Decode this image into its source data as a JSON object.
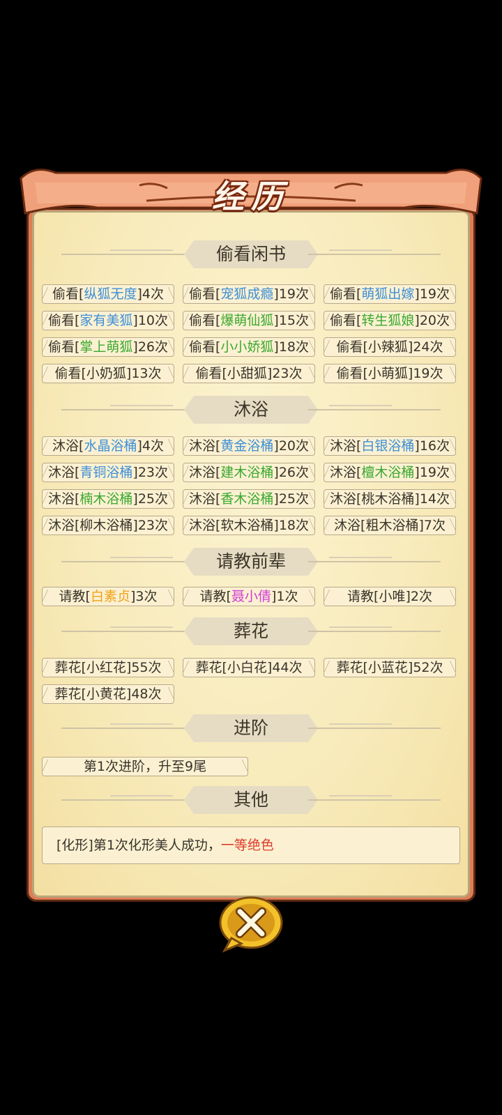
{
  "title": "经历",
  "sections": {
    "peek": {
      "header": "偷看闲书",
      "items": [
        {
          "pre": "偷看[",
          "name": "纵狐无度",
          "post": "]4次",
          "color": "blue"
        },
        {
          "pre": "偷看[",
          "name": "宠狐成瘾",
          "post": "]19次",
          "color": "blue"
        },
        {
          "pre": "偷看[",
          "name": "萌狐出嫁",
          "post": "]19次",
          "color": "blue"
        },
        {
          "pre": "偷看[",
          "name": "家有美狐",
          "post": "]10次",
          "color": "blue"
        },
        {
          "pre": "偷看[",
          "name": "爆萌仙狐",
          "post": "]15次",
          "color": "green"
        },
        {
          "pre": "偷看[",
          "name": "转生狐娘",
          "post": "]20次",
          "color": "green"
        },
        {
          "pre": "偷看[",
          "name": "掌上萌狐",
          "post": "]26次",
          "color": "green"
        },
        {
          "pre": "偷看[",
          "name": "小小娇狐",
          "post": "]18次",
          "color": "green"
        },
        {
          "pre": "偷看[",
          "name": "小辣狐",
          "post": "]24次",
          "color": "plain"
        },
        {
          "pre": "偷看[",
          "name": "小奶狐",
          "post": "]13次",
          "color": "plain"
        },
        {
          "pre": "偷看[",
          "name": "小甜狐",
          "post": "]23次",
          "color": "plain"
        },
        {
          "pre": "偷看[",
          "name": "小萌狐",
          "post": "]19次",
          "color": "plain"
        }
      ]
    },
    "bath": {
      "header": "沐浴",
      "items": [
        {
          "pre": "沐浴[",
          "name": "水晶浴桶",
          "post": "]4次",
          "color": "blue"
        },
        {
          "pre": "沐浴[",
          "name": "黄金浴桶",
          "post": "]20次",
          "color": "blue"
        },
        {
          "pre": "沐浴[",
          "name": "白银浴桶",
          "post": "]16次",
          "color": "blue"
        },
        {
          "pre": "沐浴[",
          "name": "青铜浴桶",
          "post": "]23次",
          "color": "blue"
        },
        {
          "pre": "沐浴[",
          "name": "建木浴桶",
          "post": "]26次",
          "color": "green"
        },
        {
          "pre": "沐浴[",
          "name": "檀木浴桶",
          "post": "]19次",
          "color": "green"
        },
        {
          "pre": "沐浴[",
          "name": "楠木浴桶",
          "post": "]25次",
          "color": "green"
        },
        {
          "pre": "沐浴[",
          "name": "香木浴桶",
          "post": "]25次",
          "color": "green"
        },
        {
          "pre": "沐浴[",
          "name": "桃木浴桶",
          "post": "]14次",
          "color": "plain"
        },
        {
          "pre": "沐浴[",
          "name": "柳木浴桶",
          "post": "]23次",
          "color": "plain"
        },
        {
          "pre": "沐浴[",
          "name": "软木浴桶",
          "post": "]18次",
          "color": "plain"
        },
        {
          "pre": "沐浴[",
          "name": "粗木浴桶",
          "post": "]7次",
          "color": "plain"
        }
      ]
    },
    "consult": {
      "header": "请教前辈",
      "items": [
        {
          "pre": "请教[",
          "name": "白素贞",
          "post": "]3次",
          "color": "orange"
        },
        {
          "pre": "请教[",
          "name": "聂小倩",
          "post": "]1次",
          "color": "pink"
        },
        {
          "pre": "请教[",
          "name": "小唯",
          "post": "]2次",
          "color": "plain"
        }
      ]
    },
    "flowers": {
      "header": "葬花",
      "items": [
        {
          "pre": "葬花[",
          "name": "小红花",
          "post": "]55次",
          "color": "plain"
        },
        {
          "pre": "葬花[",
          "name": "小白花",
          "post": "]44次",
          "color": "plain"
        },
        {
          "pre": "葬花[",
          "name": "小蓝花",
          "post": "]52次",
          "color": "plain"
        },
        {
          "pre": "葬花[",
          "name": "小黄花",
          "post": "]48次",
          "color": "plain"
        }
      ]
    },
    "advance": {
      "header": "进阶",
      "text": "第1次进阶，升至9尾"
    },
    "other": {
      "header": "其他",
      "text_main": "[化形]第1次化形美人成功，",
      "text_highlight": "一等绝色"
    }
  },
  "colors": {
    "blue": "#3e8fd6",
    "green": "#3aa82e",
    "orange": "#f0a21a",
    "pink": "#d43ad6",
    "red": "#e03a2a"
  },
  "close_icon": "close-x-icon"
}
